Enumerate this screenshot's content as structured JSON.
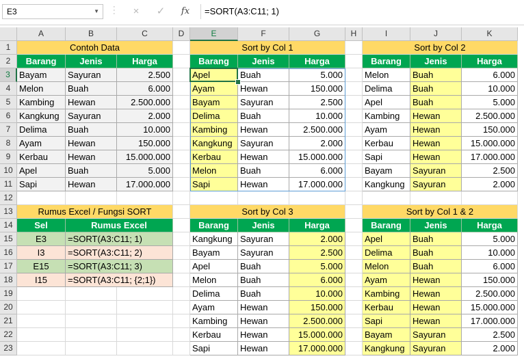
{
  "name_box": "E3",
  "formula": "=SORT(A3:C11; 1)",
  "icons": {
    "cancel": "×",
    "enter": "✓",
    "function": "fx"
  },
  "columns": [
    "A",
    "B",
    "C",
    "D",
    "E",
    "F",
    "G",
    "H",
    "I",
    "J",
    "K"
  ],
  "rows": [
    "1",
    "2",
    "3",
    "4",
    "5",
    "6",
    "7",
    "8",
    "9",
    "10",
    "11",
    "12",
    "13",
    "14",
    "15",
    "16",
    "17",
    "18",
    "19",
    "20",
    "21",
    "22",
    "23"
  ],
  "selected_col": "E",
  "selected_row": "3",
  "colors": {
    "title_fill": "#ffd966",
    "header_fill": "#00a651",
    "highlight": "#ffff99",
    "gray_cell": "#f2f2f2",
    "rumus_green": "#c6e0b4",
    "rumus_orange": "#fce4d6",
    "accent": "#217346"
  },
  "tables": [
    {
      "title": "Contoh Data",
      "pos": [
        0,
        0
      ],
      "cols": 3,
      "headers": [
        "Barang",
        "Jenis",
        "Harga"
      ],
      "highlight": [],
      "gray": true,
      "rows": [
        [
          "Bayam",
          "Sayuran",
          "2.500"
        ],
        [
          "Melon",
          "Buah",
          "6.000"
        ],
        [
          "Kambing",
          "Hewan",
          "2.500.000"
        ],
        [
          "Kangkung",
          "Sayuran",
          "2.000"
        ],
        [
          "Delima",
          "Buah",
          "10.000"
        ],
        [
          "Ayam",
          "Hewan",
          "150.000"
        ],
        [
          "Kerbau",
          "Hewan",
          "15.000.000"
        ],
        [
          "Apel",
          "Buah",
          "5.000"
        ],
        [
          "Sapi",
          "Hewan",
          "17.000.000"
        ]
      ]
    },
    {
      "title": "Sort by Col 1",
      "pos": [
        0,
        4
      ],
      "cols": 3,
      "headers": [
        "Barang",
        "Jenis",
        "Harga"
      ],
      "highlight": [
        0
      ],
      "rows": [
        [
          "Apel",
          "Buah",
          "5.000"
        ],
        [
          "Ayam",
          "Hewan",
          "150.000"
        ],
        [
          "Bayam",
          "Sayuran",
          "2.500"
        ],
        [
          "Delima",
          "Buah",
          "10.000"
        ],
        [
          "Kambing",
          "Hewan",
          "2.500.000"
        ],
        [
          "Kangkung",
          "Sayuran",
          "2.000"
        ],
        [
          "Kerbau",
          "Hewan",
          "15.000.000"
        ],
        [
          "Melon",
          "Buah",
          "6.000"
        ],
        [
          "Sapi",
          "Hewan",
          "17.000.000"
        ]
      ]
    },
    {
      "title": "Sort by Col 2",
      "pos": [
        0,
        8
      ],
      "cols": 3,
      "headers": [
        "Barang",
        "Jenis",
        "Harga"
      ],
      "highlight": [
        1
      ],
      "rows": [
        [
          "Melon",
          "Buah",
          "6.000"
        ],
        [
          "Delima",
          "Buah",
          "10.000"
        ],
        [
          "Apel",
          "Buah",
          "5.000"
        ],
        [
          "Kambing",
          "Hewan",
          "2.500.000"
        ],
        [
          "Ayam",
          "Hewan",
          "150.000"
        ],
        [
          "Kerbau",
          "Hewan",
          "15.000.000"
        ],
        [
          "Sapi",
          "Hewan",
          "17.000.000"
        ],
        [
          "Bayam",
          "Sayuran",
          "2.500"
        ],
        [
          "Kangkung",
          "Sayuran",
          "2.000"
        ]
      ]
    },
    {
      "title": "Sort by Col 3",
      "pos": [
        12,
        4
      ],
      "cols": 3,
      "headers": [
        "Barang",
        "Jenis",
        "Harga"
      ],
      "highlight": [
        2
      ],
      "rows": [
        [
          "Kangkung",
          "Sayuran",
          "2.000"
        ],
        [
          "Bayam",
          "Sayuran",
          "2.500"
        ],
        [
          "Apel",
          "Buah",
          "5.000"
        ],
        [
          "Melon",
          "Buah",
          "6.000"
        ],
        [
          "Delima",
          "Buah",
          "10.000"
        ],
        [
          "Ayam",
          "Hewan",
          "150.000"
        ],
        [
          "Kambing",
          "Hewan",
          "2.500.000"
        ],
        [
          "Kerbau",
          "Hewan",
          "15.000.000"
        ],
        [
          "Sapi",
          "Hewan",
          "17.000.000"
        ]
      ]
    },
    {
      "title": "Sort by Col 1 & 2",
      "pos": [
        12,
        8
      ],
      "cols": 3,
      "headers": [
        "Barang",
        "Jenis",
        "Harga"
      ],
      "highlight": [
        0,
        1
      ],
      "rows": [
        [
          "Apel",
          "Buah",
          "5.000"
        ],
        [
          "Delima",
          "Buah",
          "10.000"
        ],
        [
          "Melon",
          "Buah",
          "6.000"
        ],
        [
          "Ayam",
          "Hewan",
          "150.000"
        ],
        [
          "Kambing",
          "Hewan",
          "2.500.000"
        ],
        [
          "Kerbau",
          "Hewan",
          "15.000.000"
        ],
        [
          "Sapi",
          "Hewan",
          "17.000.000"
        ],
        [
          "Bayam",
          "Sayuran",
          "2.500"
        ],
        [
          "Kangkung",
          "Sayuran",
          "2.000"
        ]
      ]
    }
  ],
  "rumus": {
    "title": "Rumus Excel / Fungsi SORT",
    "headers": [
      "Sel",
      "Rumus Excel"
    ],
    "rows": [
      {
        "cell": "E3",
        "formula": "=SORT(A3:C11; 1)",
        "tone": "green"
      },
      {
        "cell": "I3",
        "formula": "=SORT(A3:C11; 2)",
        "tone": "orange"
      },
      {
        "cell": "E15",
        "formula": "=SORT(A3:C11; 3)",
        "tone": "green"
      },
      {
        "cell": "I15",
        "formula": "=SORT(A3:C11; {2;1})",
        "tone": "orange"
      }
    ]
  }
}
